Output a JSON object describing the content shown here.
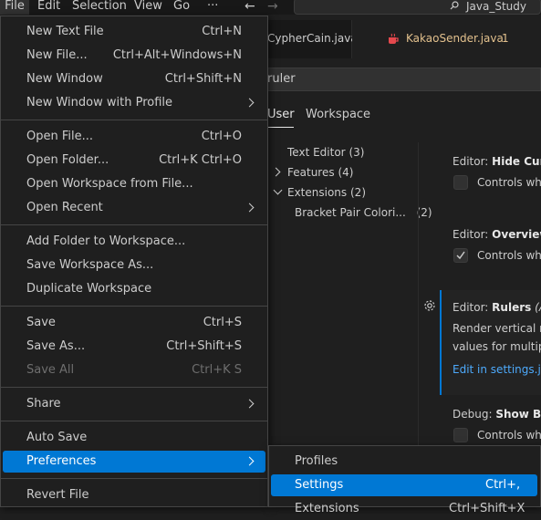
{
  "menubar": {
    "items": [
      "File",
      "Edit",
      "Selection",
      "View",
      "Go",
      "···"
    ],
    "search_text": "Java_Study"
  },
  "tabs": [
    {
      "label": "CypherCain.java"
    },
    {
      "label": "KakaoSender.java",
      "badge": "1"
    }
  ],
  "settings": {
    "search_value": "ruler",
    "scope_tabs": [
      "User",
      "Workspace"
    ],
    "tree": [
      {
        "label": "Text Editor",
        "count": "(3)"
      },
      {
        "label": "Features",
        "count": "(4)"
      },
      {
        "label": "Extensions",
        "count": "(2)"
      },
      {
        "label": "Bracket Pair Colori...",
        "count": "(2)"
      }
    ],
    "items": [
      {
        "prefix": "Editor: ",
        "name": "Hide Curs",
        "desc": "Controls whe"
      },
      {
        "prefix": "Editor: ",
        "name": "Overview",
        "desc": "Controls whe",
        "checked": true
      },
      {
        "prefix": "Editor: ",
        "name": "Rulers",
        "suffix": " (A",
        "desc": "Render vertical ru",
        "desc2": "values for multip",
        "link": "Edit in settings.js"
      },
      {
        "prefix": "Debug: ",
        "name": "Show Bre",
        "desc": "Controls whe"
      }
    ]
  },
  "file_menu": {
    "groups": [
      [
        {
          "label": "New Text File",
          "shortcut": "Ctrl+N"
        },
        {
          "label": "New File...",
          "shortcut": "Ctrl+Alt+Windows+N"
        },
        {
          "label": "New Window",
          "shortcut": "Ctrl+Shift+N"
        },
        {
          "label": "New Window with Profile",
          "submenu": true
        }
      ],
      [
        {
          "label": "Open File...",
          "shortcut": "Ctrl+O"
        },
        {
          "label": "Open Folder...",
          "shortcut": "Ctrl+K Ctrl+O"
        },
        {
          "label": "Open Workspace from File..."
        },
        {
          "label": "Open Recent",
          "submenu": true
        }
      ],
      [
        {
          "label": "Add Folder to Workspace..."
        },
        {
          "label": "Save Workspace As..."
        },
        {
          "label": "Duplicate Workspace"
        }
      ],
      [
        {
          "label": "Save",
          "shortcut": "Ctrl+S"
        },
        {
          "label": "Save As...",
          "shortcut": "Ctrl+Shift+S"
        },
        {
          "label": "Save All",
          "shortcut": "Ctrl+K S",
          "disabled": true
        }
      ],
      [
        {
          "label": "Share",
          "submenu": true
        }
      ],
      [
        {
          "label": "Auto Save"
        },
        {
          "label": "Preferences",
          "submenu": true,
          "active": true
        }
      ],
      [
        {
          "label": "Revert File"
        }
      ]
    ]
  },
  "preferences_submenu": [
    {
      "label": "Profiles"
    },
    {
      "label": "Settings",
      "shortcut": "Ctrl+,",
      "active": true
    },
    {
      "label": "Extensions",
      "shortcut": "Ctrl+Shift+X"
    }
  ],
  "colors": {
    "accent": "#0078d4",
    "menu_bg": "#1f1f1f",
    "tab_modified": "#e2c08d",
    "java_icon": "#e5484d",
    "link": "#4daafc"
  },
  "icons": [
    "search-icon",
    "back-arrow-icon",
    "forward-arrow-icon",
    "java-file-icon",
    "chevron-right-icon",
    "chevron-down-icon",
    "gear-icon",
    "check-icon"
  ]
}
